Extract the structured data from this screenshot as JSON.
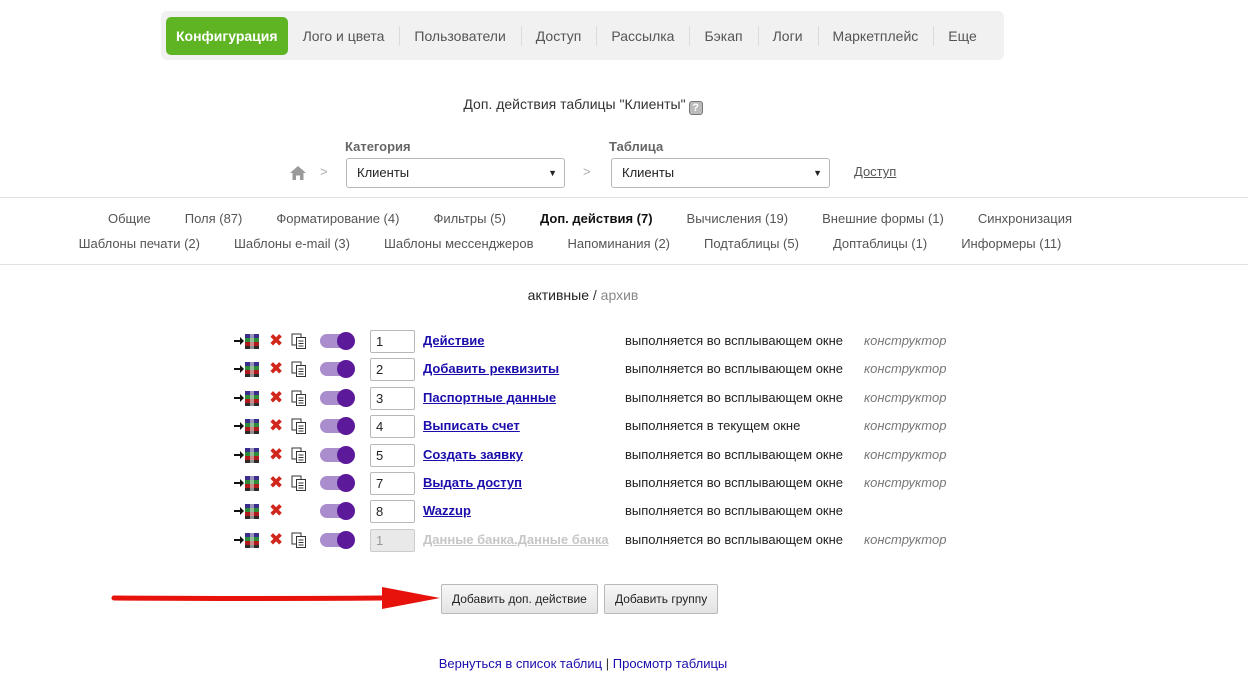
{
  "topnav": {
    "items": [
      {
        "label": "Конфигурация",
        "active": true
      },
      {
        "label": "Лого и цвета"
      },
      {
        "label": "Пользователи"
      },
      {
        "label": "Доступ"
      },
      {
        "label": "Рассылка"
      },
      {
        "label": "Бэкап"
      },
      {
        "label": "Логи"
      },
      {
        "label": "Маркетплейс"
      },
      {
        "label": "Еще"
      }
    ]
  },
  "page": {
    "title": "Доп. действия таблицы \"Клиенты\"",
    "help": "?"
  },
  "selectors": {
    "category_label": "Категория",
    "category_value": "Клиенты",
    "table_label": "Таблица",
    "table_value": "Клиенты",
    "separator": ">",
    "access_link": "Доступ"
  },
  "tabs": {
    "row1": [
      "Общие",
      "Поля (87)",
      "Форматирование (4)",
      "Фильтры (5)",
      "Доп. действия (7)",
      "Вычисления (19)",
      "Внешние формы (1)",
      "Синхронизация"
    ],
    "row2": [
      "Шаблоны печати (2)",
      "Шаблоны e-mail (3)",
      "Шаблоны мессенджеров",
      "Напоминания (2)",
      "Подтаблицы (5)",
      "Доптаблицы (1)",
      "Информеры (11)"
    ],
    "active": "Доп. действия (7)"
  },
  "status": {
    "active": "активные",
    "divider": "/",
    "archive": "архив"
  },
  "actions": [
    {
      "order": "1",
      "name": "Действие",
      "mode": "выполняется во всплывающем окне",
      "kind": "конструктор",
      "copy": true,
      "disabled": false
    },
    {
      "order": "2",
      "name": "Добавить реквизиты",
      "mode": "выполняется во всплывающем окне",
      "kind": "конструктор",
      "copy": true,
      "disabled": false
    },
    {
      "order": "3",
      "name": "Паспортные данные",
      "mode": "выполняется во всплывающем окне",
      "kind": "конструктор",
      "copy": true,
      "disabled": false
    },
    {
      "order": "4",
      "name": "Выписать счет",
      "mode": "выполняется в текущем окне",
      "kind": "конструктор",
      "copy": true,
      "disabled": false
    },
    {
      "order": "5",
      "name": "Создать заявку",
      "mode": "выполняется во всплывающем окне",
      "kind": "конструктор",
      "copy": true,
      "disabled": false
    },
    {
      "order": "7",
      "name": "Выдать доступ",
      "mode": "выполняется во всплывающем окне",
      "kind": "конструктор",
      "copy": true,
      "disabled": false
    },
    {
      "order": "8",
      "name": "Wazzup",
      "mode": "выполняется во всплывающем окне",
      "kind": "",
      "copy": false,
      "disabled": false
    },
    {
      "order": "1",
      "name": "Данные банка.Данные банка",
      "mode": "выполняется во всплывающем окне",
      "kind": "конструктор",
      "copy": true,
      "disabled": true
    }
  ],
  "buttons": {
    "add_action": "Добавить доп. действие",
    "add_group": "Добавить группу"
  },
  "footer": {
    "back": "Вернуться в список таблиц",
    "divider": "|",
    "view": "Просмотр таблицы"
  },
  "colors": {
    "nav_active": "#5fb424",
    "delete": "#d0261b",
    "toggle_knob": "#5c1a9a",
    "link": "#1a0dab",
    "annotation_arrow": "#e8120c"
  }
}
